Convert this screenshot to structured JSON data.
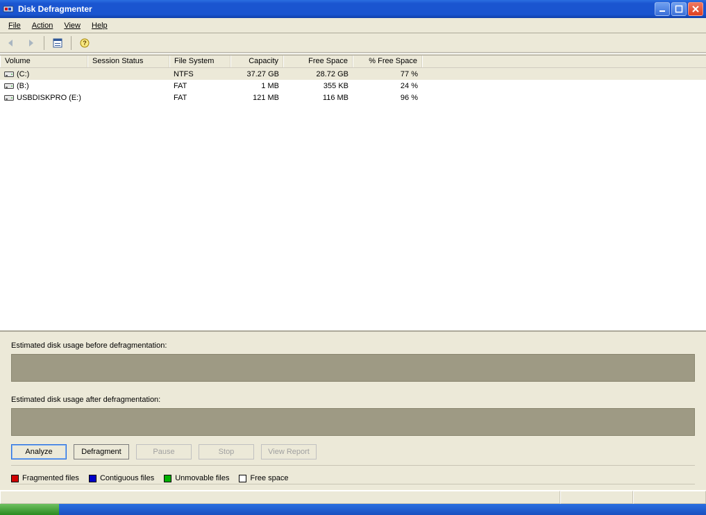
{
  "window": {
    "title": "Disk Defragmenter"
  },
  "menu": {
    "file": {
      "label": "File",
      "accel": "F"
    },
    "action": {
      "label": "Action",
      "accel": "A"
    },
    "view": {
      "label": "View",
      "accel": "V"
    },
    "help": {
      "label": "Help",
      "accel": "H"
    }
  },
  "columns": {
    "volume": "Volume",
    "sessionStatus": "Session Status",
    "fileSystem": "File System",
    "capacity": "Capacity",
    "freeSpace": "Free Space",
    "pctFreeSpace": "% Free Space"
  },
  "volumes": [
    {
      "name": "(C:)",
      "sessionStatus": "",
      "fileSystem": "NTFS",
      "capacity": "37.27 GB",
      "freeSpace": "28.72 GB",
      "pctFree": "77 %",
      "selected": true
    },
    {
      "name": "(B:)",
      "sessionStatus": "",
      "fileSystem": "FAT",
      "capacity": "1 MB",
      "freeSpace": "355 KB",
      "pctFree": "24 %",
      "selected": false
    },
    {
      "name": "USBDISKPRO (E:)",
      "sessionStatus": "",
      "fileSystem": "FAT",
      "capacity": "121 MB",
      "freeSpace": "116 MB",
      "pctFree": "96 %",
      "selected": false
    }
  ],
  "labels": {
    "beforeBar": "Estimated disk usage before defragmentation:",
    "afterBar": "Estimated disk usage after defragmentation:"
  },
  "buttons": {
    "analyze": "Analyze",
    "defragment": "Defragment",
    "pause": "Pause",
    "stop": "Stop",
    "viewReport": "View Report"
  },
  "legend": {
    "fragmented": {
      "label": "Fragmented files",
      "color": "#d00000"
    },
    "contiguous": {
      "label": "Contiguous files",
      "color": "#0000c8"
    },
    "unmovable": {
      "label": "Unmovable files",
      "color": "#00b000"
    },
    "freeSpace": {
      "label": "Free space",
      "color": "#ffffff"
    }
  }
}
